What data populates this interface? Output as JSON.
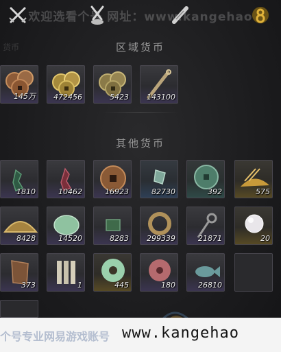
{
  "header": {
    "watermark": "欢迎选看个号 网址：www.kangehao",
    "icons": [
      "crossed-swords-icon",
      "crossed-weapons-icon",
      "scroll-icon",
      "gold-ingot-icon"
    ]
  },
  "faded_top_left": "货币",
  "sections": {
    "regional_title": "区域货币",
    "other_title": "其他货币"
  },
  "regional": [
    {
      "name": "bronze-coins",
      "count": "145万"
    },
    {
      "name": "gold-coins",
      "count": "472456"
    },
    {
      "name": "brass-coins",
      "count": "5423"
    },
    {
      "name": "silver-needle",
      "count": "143100"
    }
  ],
  "other": [
    {
      "name": "green-seal",
      "count": "1810"
    },
    {
      "name": "red-seal",
      "count": "10462"
    },
    {
      "name": "copper-cash",
      "count": "16923"
    },
    {
      "name": "jade-token",
      "count": "82730"
    },
    {
      "name": "green-coin",
      "count": "392"
    },
    {
      "name": "grain-pile",
      "count": "575"
    },
    {
      "name": "gold-dome",
      "count": "8428"
    },
    {
      "name": "jade-stone",
      "count": "14520"
    },
    {
      "name": "green-cloth",
      "count": "8283"
    },
    {
      "name": "gold-ring",
      "count": "299339"
    },
    {
      "name": "key-token",
      "count": "21871"
    },
    {
      "name": "pearl",
      "count": "20"
    },
    {
      "name": "bronze-plaque",
      "count": "373"
    },
    {
      "name": "bamboo-slips",
      "count": "1"
    },
    {
      "name": "jade-disc",
      "count": "445"
    },
    {
      "name": "red-disc",
      "count": "180"
    },
    {
      "name": "fish-token",
      "count": "26810"
    }
  ],
  "banner": {
    "left_text": "个号专业网易游戏账号",
    "url": "www.kangehao"
  },
  "colors": {
    "slot_purple": "#3b3550",
    "slot_gold": "#574a25",
    "slot_green": "#2f4a47",
    "slot_blue": "#2e3f55"
  }
}
